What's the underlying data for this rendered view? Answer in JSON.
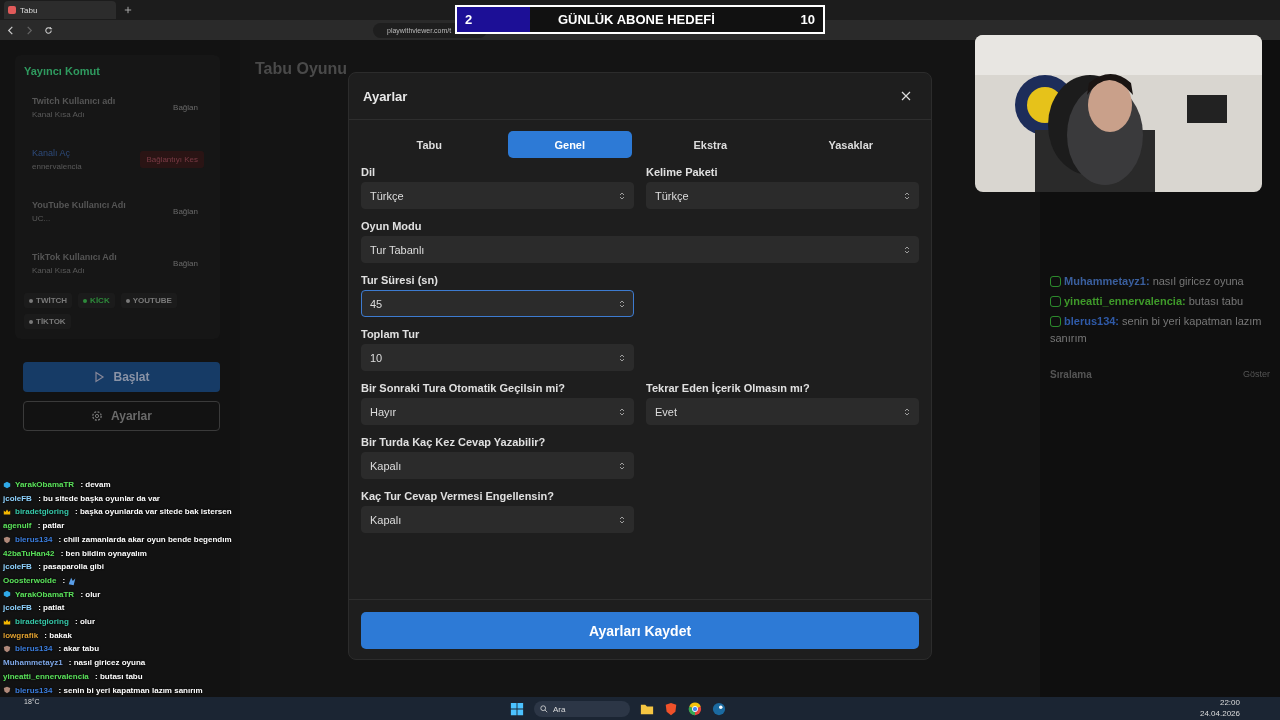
{
  "browser": {
    "tab_title": "Tabu",
    "url": "playwithviewer.com/t"
  },
  "goal": {
    "current": "2",
    "title": "GÜNLÜK ABONE HEDEFİ",
    "target": "10",
    "level": 0.2
  },
  "sidebar": {
    "title": "Yayıncı Komut",
    "accounts": [
      {
        "label": "Twitch Kullanıcı adı",
        "hint": "Kanal Kısa Adı",
        "action": "Bağlan",
        "connected": false
      },
      {
        "label": "Kanalı Aç",
        "hint": "ennervalencia",
        "action": "Bağlantıyı Kes",
        "connected": true
      },
      {
        "label": "YouTube Kullanıcı Adı",
        "hint": "UC...",
        "action": "Bağlan",
        "connected": false
      },
      {
        "label": "TikTok Kullanıcı Adı",
        "hint": "Kanal Kısa Adı",
        "action": "Bağlan",
        "connected": false
      }
    ],
    "platforms": [
      {
        "name": "TWİTCH",
        "active": false
      },
      {
        "name": "KİCK",
        "active": true
      },
      {
        "name": "YOUTUBE",
        "active": false
      },
      {
        "name": "TİKTOK",
        "active": false
      }
    ],
    "start_button": "Başlat",
    "settings_button": "Ayarlar"
  },
  "page_title": "Tabu Oyunu",
  "modal": {
    "title": "Ayarlar",
    "tabs": [
      {
        "label": "Tabu",
        "selected": false
      },
      {
        "label": "Genel",
        "selected": true
      },
      {
        "label": "Ekstra",
        "selected": false
      },
      {
        "label": "Yasaklar",
        "selected": false
      }
    ],
    "rows": [
      {
        "kind": "half",
        "fields": [
          {
            "label": "Dil",
            "value": "Türkçe",
            "focused": false
          },
          {
            "label": "Kelime Paketi",
            "value": "Türkçe",
            "focused": false
          }
        ]
      },
      {
        "kind": "full",
        "fields": [
          {
            "label": "Oyun Modu",
            "value": "Tur Tabanlı",
            "focused": false
          }
        ]
      },
      {
        "kind": "half",
        "fields": [
          {
            "label": "Tur Süresi (sn)",
            "value": "45",
            "focused": true
          }
        ]
      },
      {
        "kind": "half",
        "fields": [
          {
            "label": "Toplam Tur",
            "value": "10",
            "focused": false
          }
        ]
      },
      {
        "kind": "half",
        "fields": [
          {
            "label": "Bir Sonraki Tura Otomatik Geçilsin mi?",
            "value": "Hayır",
            "focused": false
          },
          {
            "label": "Tekrar Eden İçerik Olmasın mı?",
            "value": "Evet",
            "focused": false
          }
        ]
      },
      {
        "kind": "half",
        "fields": [
          {
            "label": "Bir Turda Kaç Kez Cevap Yazabilir?",
            "value": "Kapalı",
            "focused": false
          }
        ]
      },
      {
        "kind": "half",
        "fields": [
          {
            "label": "Kaç Tur Cevap Vermesi Engellensin?",
            "value": "Kapalı",
            "focused": false
          }
        ]
      }
    ],
    "save_button": "Ayarları Kaydet"
  },
  "stream_chat": [
    {
      "user": "Muhammetayz1:",
      "text": "nasıl giricez oyuna",
      "color": "#3a5f9e"
    },
    {
      "user": "yineatti_ennervalencia:",
      "text": "butası tabu",
      "color": "#3f9a2a"
    },
    {
      "user": "blerus134:",
      "text": "senin bi yeri kapatman lazım sanırım",
      "color": "#2f5aa8"
    }
  ],
  "ranking": {
    "title": "Sıralama",
    "action": "Göster"
  },
  "overlay_chat": [
    {
      "user": "YarakObamaTR",
      "text": ": devam",
      "color": "#5be35b",
      "kind": "cube"
    },
    {
      "user": "jcoleFB",
      "text": ": bu sitede başka oyunlar da var",
      "color": "#8fd3ff",
      "kind": "plain"
    },
    {
      "user": "biradetgloring",
      "text": ": başka oyunlarda var sitede bak istersen",
      "color": "#36c7a8",
      "kind": "crown"
    },
    {
      "user": "agenulf",
      "text": ": patlar",
      "color": "#5be35b",
      "kind": "plain"
    },
    {
      "user": "blerus134",
      "text": ": chill zamanlarda akar oyun bende begendım",
      "color": "#3b7ddd",
      "kind": "shield"
    },
    {
      "user": "42baTuHan42",
      "text": ": ben bildim oynayalım",
      "color": "#5be35b",
      "kind": "plain"
    },
    {
      "user": "jcoleFB",
      "text": ": pasaparolla gibi",
      "color": "#8fd3ff",
      "kind": "plain"
    },
    {
      "user": "Ooosterwolde",
      "text": ":",
      "color": "#5be35b",
      "kind": "emote"
    },
    {
      "user": "YarakObamaTR",
      "text": ": olur",
      "color": "#5be35b",
      "kind": "cube"
    },
    {
      "user": "jcoleFB",
      "text": ": patlat",
      "color": "#8fd3ff",
      "kind": "plain"
    },
    {
      "user": "biradetgloring",
      "text": ": olur",
      "color": "#36c7a8",
      "kind": "crown"
    },
    {
      "user": "lowgrafik",
      "text": ": bakak",
      "color": "#e0a030",
      "kind": "plain"
    },
    {
      "user": "blerus134",
      "text": ": akar tabu",
      "color": "#3b7ddd",
      "kind": "shield"
    },
    {
      "user": "Muhammetayz1",
      "text": ": nasıl giricez oyuna",
      "color": "#7fa8e8",
      "kind": "plain"
    },
    {
      "user": "yineatti_ennervalencia",
      "text": ": butası tabu",
      "color": "#5be35b",
      "kind": "plain"
    },
    {
      "user": "blerus134",
      "text": ": senin bi yeri kapatman lazım sanırım",
      "color": "#3b7ddd",
      "kind": "shield"
    }
  ],
  "taskbar": {
    "weather": "18°C",
    "search": "Ara",
    "time": "22:00",
    "date": "24.04.2026"
  }
}
